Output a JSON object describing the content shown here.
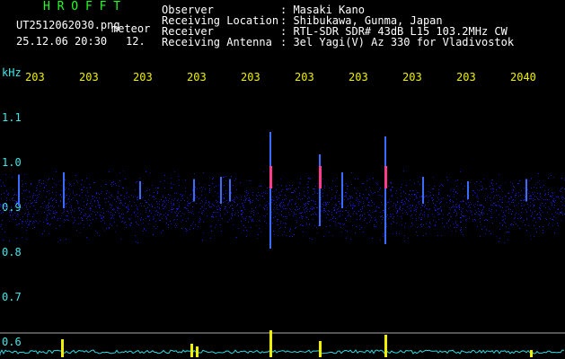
{
  "header": {
    "brand": "H R O F F T",
    "filename": "UT2512062030.png",
    "product": "meteor",
    "datetime": "25.12.06 20:30",
    "count": "12."
  },
  "meta": {
    "observer_label": "Observer",
    "observer_value": ": Masaki Kano",
    "location_label": "Receiving Location",
    "location_value": ": Shibukawa, Gunma, Japan",
    "receiver_label": "Receiver",
    "receiver_value": ": RTL-SDR SDR# 43dB L15 103.2MHz CW",
    "antenna_label": "Receiving Antenna",
    "antenna_value": ": 3el Yagi(V) Az 330 for Vladivostok"
  },
  "axis": {
    "unit": "kHz",
    "y_ticks": [
      "1.1",
      "1.0",
      "0.9",
      "0.8",
      "0.7",
      "0.6"
    ],
    "x_ticks": [
      "203",
      "203",
      "203",
      "203",
      "203",
      "203",
      "203",
      "203",
      "203",
      "2040"
    ]
  },
  "colors": {
    "axis_text": "#40e8e8",
    "time_text": "#f0f000",
    "brand": "#20ff20",
    "noise": "#1a22c0",
    "meteor_core": "#ff3c8c",
    "baseline": "#30d8e0",
    "peak": "#f0f000"
  }
}
